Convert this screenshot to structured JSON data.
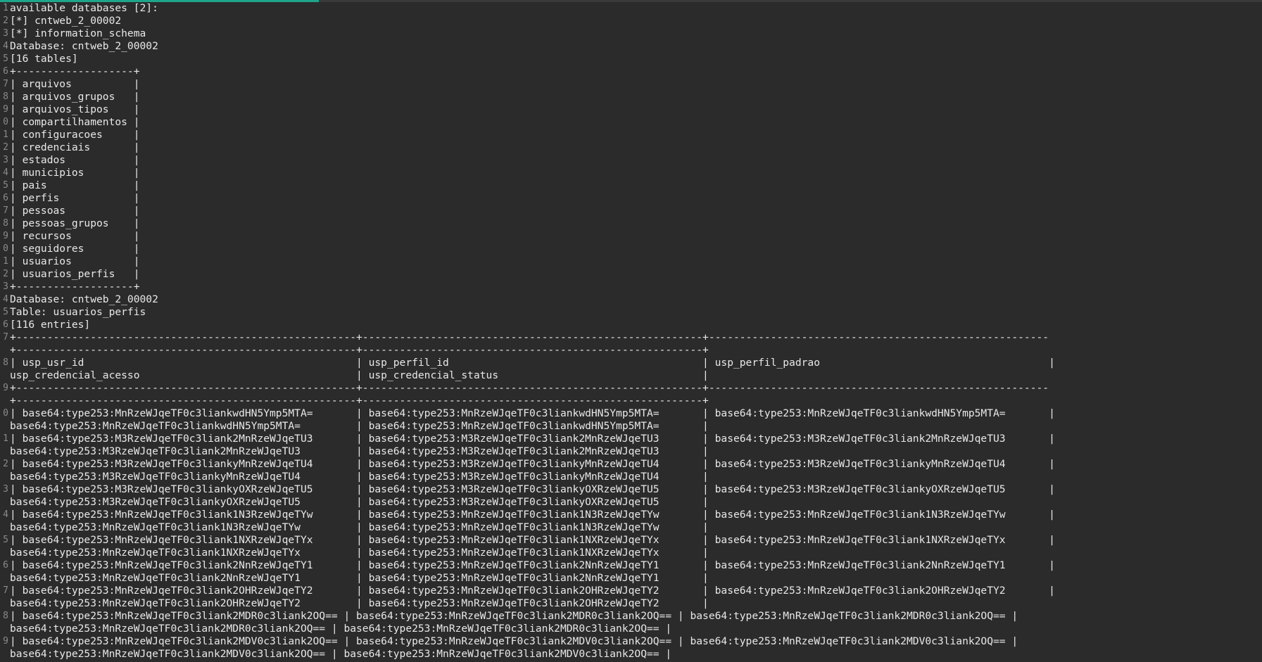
{
  "colors": {
    "background": "#2b2b2b",
    "text": "#e8e8e8",
    "line_number": "#8a8a8a",
    "scroll_thumb": "#1fa68a"
  },
  "lines": [
    {
      "num": "1",
      "text": "available databases [2]:"
    },
    {
      "num": "2",
      "text": "[*] cntweb_2_00002"
    },
    {
      "num": "3",
      "text": "[*] information_schema"
    },
    {
      "num": "4",
      "text": "Database: cntweb_2_00002"
    },
    {
      "num": "5",
      "text": "[16 tables]"
    },
    {
      "num": "6",
      "text": "+-------------------+"
    },
    {
      "num": "7",
      "text": "| arquivos          |"
    },
    {
      "num": "8",
      "text": "| arquivos_grupos   |"
    },
    {
      "num": "9",
      "text": "| arquivos_tipos    |"
    },
    {
      "num": "0",
      "text": "| compartilhamentos |"
    },
    {
      "num": "1",
      "text": "| configuracoes     |"
    },
    {
      "num": "2",
      "text": "| credenciais       |"
    },
    {
      "num": "3",
      "text": "| estados           |"
    },
    {
      "num": "4",
      "text": "| municipios        |"
    },
    {
      "num": "5",
      "text": "| pais              |"
    },
    {
      "num": "6",
      "text": "| perfis            |"
    },
    {
      "num": "7",
      "text": "| pessoas           |"
    },
    {
      "num": "8",
      "text": "| pessoas_grupos    |"
    },
    {
      "num": "9",
      "text": "| recursos          |"
    },
    {
      "num": "0",
      "text": "| seguidores        |"
    },
    {
      "num": "1",
      "text": "| usuarios          |"
    },
    {
      "num": "2",
      "text": "| usuarios_perfis   |"
    },
    {
      "num": "3",
      "text": "+-------------------+"
    },
    {
      "num": "4",
      "text": "Database: cntweb_2_00002"
    },
    {
      "num": "5",
      "text": "Table: usuarios_perfis"
    },
    {
      "num": "6",
      "text": "[116 entries]"
    },
    {
      "num": "7",
      "text": "+-------------------------------------------------------+-------------------------------------------------------+-------------------------------------------------------"
    },
    {
      "num": "",
      "text": "+-------------------------------------------------------+-------------------------------------------------------+"
    },
    {
      "num": "8",
      "text": "| usp_usr_id                                            | usp_perfil_id                                         | usp_perfil_padrao                                     |"
    },
    {
      "num": "",
      "text": "usp_credencial_acesso                                   | usp_credencial_status                                 |"
    },
    {
      "num": "9",
      "text": "+-------------------------------------------------------+-------------------------------------------------------+-------------------------------------------------------"
    },
    {
      "num": "",
      "text": "+-------------------------------------------------------+-------------------------------------------------------+"
    },
    {
      "num": "0",
      "text": "| base64:type253:MnRzeWJqeTF0c3liankwdHN5Ymp5MTA=       | base64:type253:MnRzeWJqeTF0c3liankwdHN5Ymp5MTA=       | base64:type253:MnRzeWJqeTF0c3liankwdHN5Ymp5MTA=       |"
    },
    {
      "num": "",
      "text": "base64:type253:MnRzeWJqeTF0c3liankwdHN5Ymp5MTA=         | base64:type253:MnRzeWJqeTF0c3liankwdHN5Ymp5MTA=       |"
    },
    {
      "num": "1",
      "text": "| base64:type253:M3RzeWJqeTF0c3liank2MnRzeWJqeTU3       | base64:type253:M3RzeWJqeTF0c3liank2MnRzeWJqeTU3       | base64:type253:M3RzeWJqeTF0c3liank2MnRzeWJqeTU3       |"
    },
    {
      "num": "",
      "text": "base64:type253:M3RzeWJqeTF0c3liank2MnRzeWJqeTU3         | base64:type253:M3RzeWJqeTF0c3liank2MnRzeWJqeTU3       |"
    },
    {
      "num": "2",
      "text": "| base64:type253:M3RzeWJqeTF0c3liankyMnRzeWJqeTU4       | base64:type253:M3RzeWJqeTF0c3liankyMnRzeWJqeTU4       | base64:type253:M3RzeWJqeTF0c3liankyMnRzeWJqeTU4       |"
    },
    {
      "num": "",
      "text": "base64:type253:M3RzeWJqeTF0c3liankyMnRzeWJqeTU4         | base64:type253:M3RzeWJqeTF0c3liankyMnRzeWJqeTU4       |"
    },
    {
      "num": "3",
      "text": "| base64:type253:M3RzeWJqeTF0c3liankyOXRzeWJqeTU5       | base64:type253:M3RzeWJqeTF0c3liankyOXRzeWJqeTU5       | base64:type253:M3RzeWJqeTF0c3liankyOXRzeWJqeTU5       |"
    },
    {
      "num": "",
      "text": "base64:type253:M3RzeWJqeTF0c3liankyOXRzeWJqeTU5         | base64:type253:M3RzeWJqeTF0c3liankyOXRzeWJqeTU5       |"
    },
    {
      "num": "4",
      "text": "| base64:type253:MnRzeWJqeTF0c3liank1N3RzeWJqeTYw       | base64:type253:MnRzeWJqeTF0c3liank1N3RzeWJqeTYw       | base64:type253:MnRzeWJqeTF0c3liank1N3RzeWJqeTYw       |"
    },
    {
      "num": "",
      "text": "base64:type253:MnRzeWJqeTF0c3liank1N3RzeWJqeTYw         | base64:type253:MnRzeWJqeTF0c3liank1N3RzeWJqeTYw       |"
    },
    {
      "num": "5",
      "text": "| base64:type253:MnRzeWJqeTF0c3liank1NXRzeWJqeTYx       | base64:type253:MnRzeWJqeTF0c3liank1NXRzeWJqeTYx       | base64:type253:MnRzeWJqeTF0c3liank1NXRzeWJqeTYx       |"
    },
    {
      "num": "",
      "text": "base64:type253:MnRzeWJqeTF0c3liank1NXRzeWJqeTYx         | base64:type253:MnRzeWJqeTF0c3liank1NXRzeWJqeTYx       |"
    },
    {
      "num": "6",
      "text": "| base64:type253:MnRzeWJqeTF0c3liank2NnRzeWJqeTY1       | base64:type253:MnRzeWJqeTF0c3liank2NnRzeWJqeTY1       | base64:type253:MnRzeWJqeTF0c3liank2NnRzeWJqeTY1       |"
    },
    {
      "num": "",
      "text": "base64:type253:MnRzeWJqeTF0c3liank2NnRzeWJqeTY1         | base64:type253:MnRzeWJqeTF0c3liank2NnRzeWJqeTY1       |"
    },
    {
      "num": "7",
      "text": "| base64:type253:MnRzeWJqeTF0c3liank2OHRzeWJqeTY2       | base64:type253:MnRzeWJqeTF0c3liank2OHRzeWJqeTY2       | base64:type253:MnRzeWJqeTF0c3liank2OHRzeWJqeTY2       |"
    },
    {
      "num": "",
      "text": "base64:type253:MnRzeWJqeTF0c3liank2OHRzeWJqeTY2         | base64:type253:MnRzeWJqeTF0c3liank2OHRzeWJqeTY2       |"
    },
    {
      "num": "8",
      "text": "| base64:type253:MnRzeWJqeTF0c3liank2MDR0c3liank2OQ== | base64:type253:MnRzeWJqeTF0c3liank2MDR0c3liank2OQ== | base64:type253:MnRzeWJqeTF0c3liank2MDR0c3liank2OQ== |"
    },
    {
      "num": "",
      "text": "base64:type253:MnRzeWJqeTF0c3liank2MDR0c3liank2OQ== | base64:type253:MnRzeWJqeTF0c3liank2MDR0c3liank2OQ== |"
    },
    {
      "num": "9",
      "text": "| base64:type253:MnRzeWJqeTF0c3liank2MDV0c3liank2OQ== | base64:type253:MnRzeWJqeTF0c3liank2MDV0c3liank2OQ== | base64:type253:MnRzeWJqeTF0c3liank2MDV0c3liank2OQ== |"
    },
    {
      "num": "",
      "text": "base64:type253:MnRzeWJqeTF0c3liank2MDV0c3liank2OQ== | base64:type253:MnRzeWJqeTF0c3liank2MDV0c3liank2OQ== |"
    }
  ]
}
